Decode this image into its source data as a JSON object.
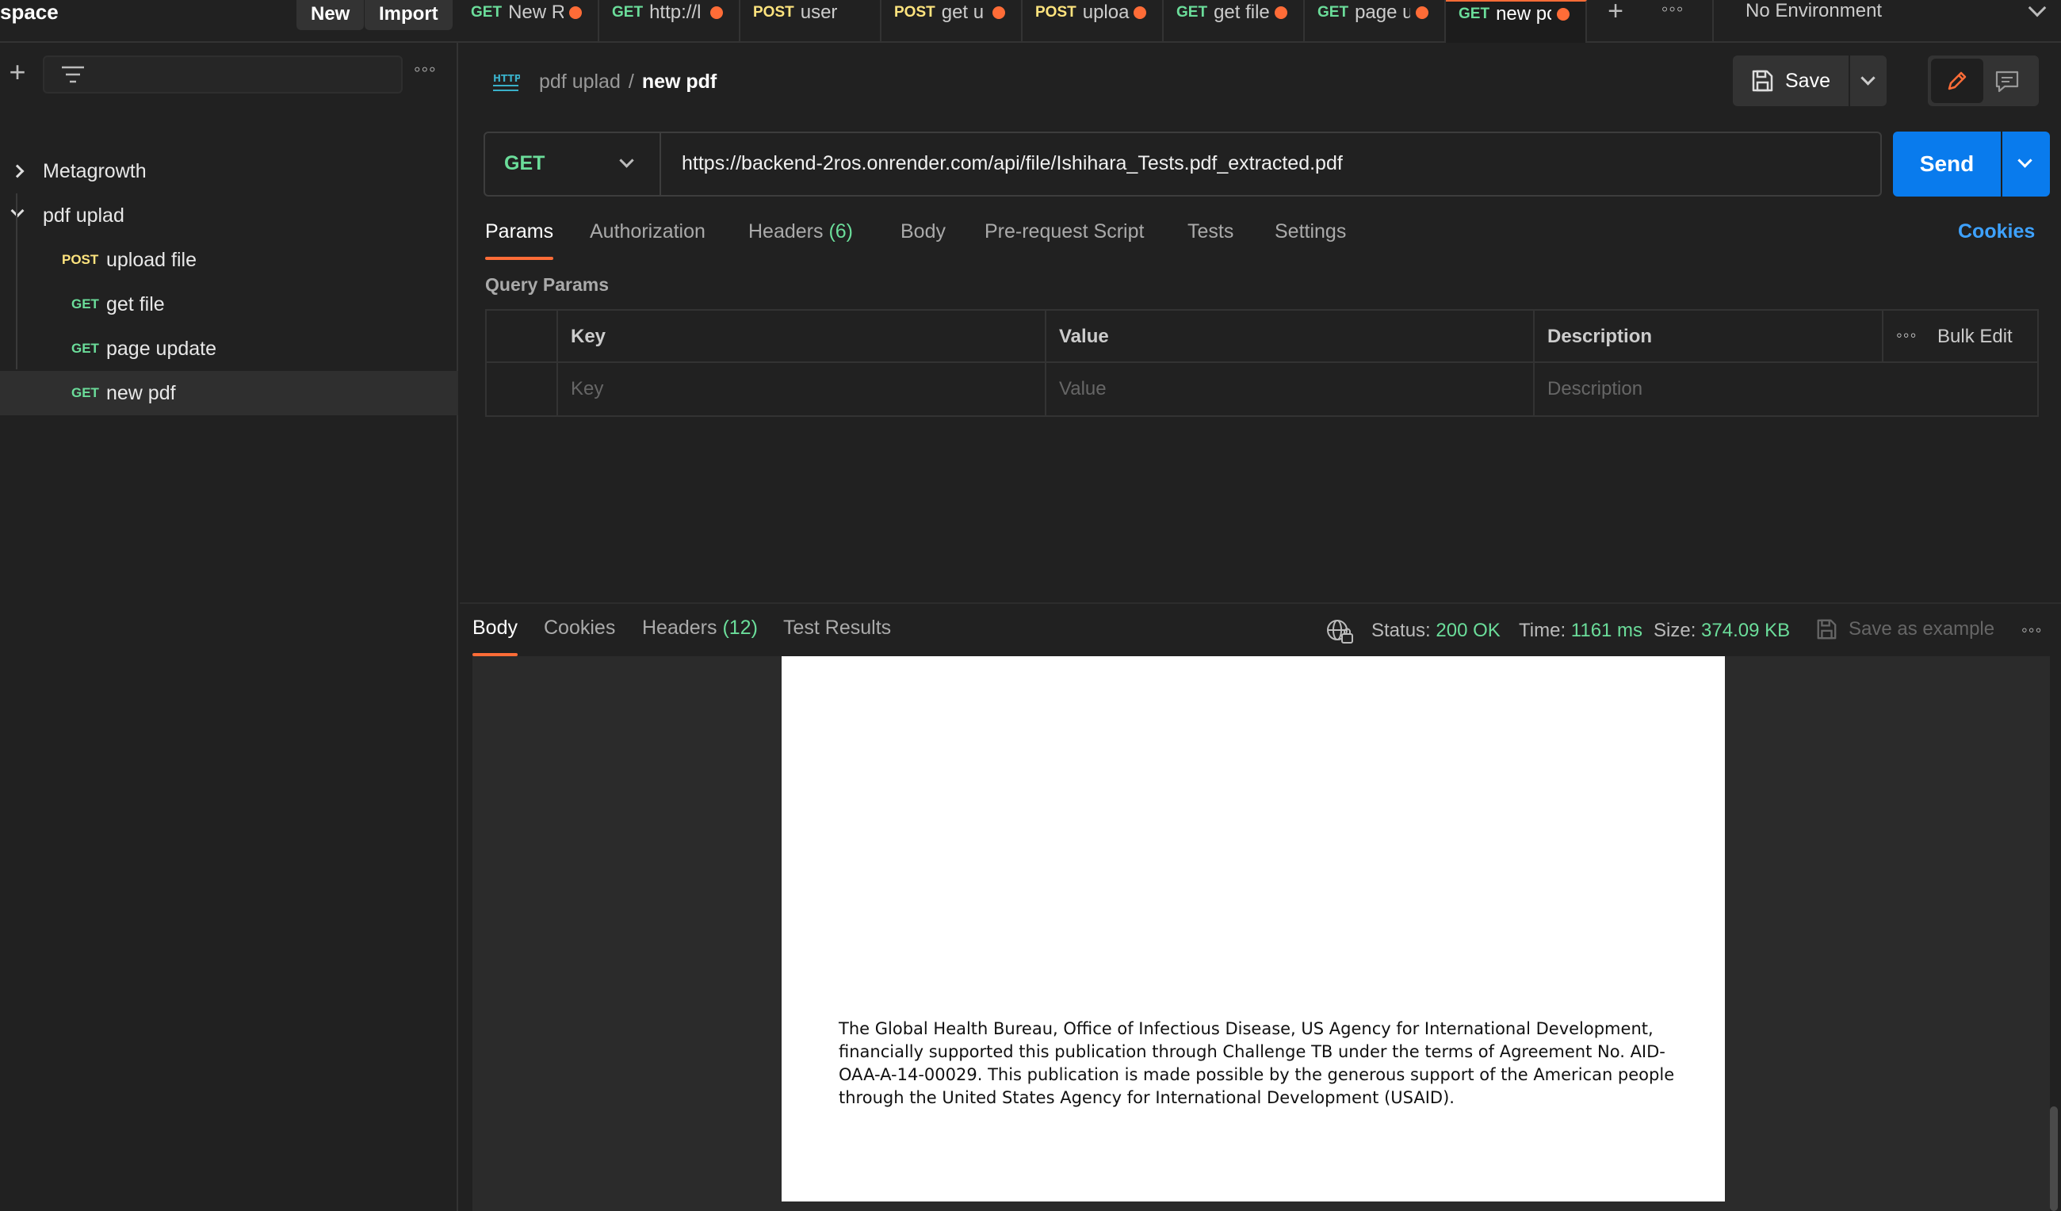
{
  "workspace": {
    "title": "space",
    "new_label": "New",
    "import_label": "Import"
  },
  "tabs": [
    {
      "method": "GET",
      "name": "New R"
    },
    {
      "method": "GET",
      "name": "http://l"
    },
    {
      "method": "POST",
      "name": "user"
    },
    {
      "method": "POST",
      "name": "get u"
    },
    {
      "method": "POST",
      "name": "uploa"
    },
    {
      "method": "GET",
      "name": "get file"
    },
    {
      "method": "GET",
      "name": "page u"
    },
    {
      "method": "GET",
      "name": "new pc"
    }
  ],
  "environment": {
    "label": "No Environment"
  },
  "sidebar": {
    "collections": [
      {
        "name": "Metagrowth",
        "expanded": false
      },
      {
        "name": "pdf uplad",
        "expanded": true
      }
    ],
    "requests": [
      {
        "method": "POST",
        "name": "upload file"
      },
      {
        "method": "GET",
        "name": "get file"
      },
      {
        "method": "GET",
        "name": "page update"
      },
      {
        "method": "GET",
        "name": "new pdf"
      }
    ]
  },
  "request": {
    "breadcrumb_collection": "pdf uplad",
    "breadcrumb_separator": "/",
    "breadcrumb_name": "new pdf",
    "save_label": "Save",
    "method": "GET",
    "url": "https://backend-2ros.onrender.com/api/file/Ishihara_Tests.pdf_extracted.pdf",
    "send_label": "Send",
    "tabs": {
      "params": "Params",
      "authorization": "Authorization",
      "headers": "Headers",
      "headers_count": "(6)",
      "body": "Body",
      "prerequest": "Pre-request Script",
      "tests": "Tests",
      "settings": "Settings"
    },
    "cookies_label": "Cookies",
    "query_params_title": "Query Params",
    "table": {
      "col_key": "Key",
      "col_value": "Value",
      "col_description": "Description",
      "bulk_edit": "Bulk Edit",
      "ph_key": "Key",
      "ph_value": "Value",
      "ph_description": "Description"
    }
  },
  "response": {
    "tabs": {
      "body": "Body",
      "cookies": "Cookies",
      "headers": "Headers",
      "headers_count": "(12)",
      "test_results": "Test Results"
    },
    "status_label": "Status:",
    "status_value": "200 OK",
    "time_label": "Time:",
    "time_value": "1161 ms",
    "size_label": "Size:",
    "size_value": "374.09 KB",
    "save_example_label": "Save as example",
    "pdf_text": "The Global Health Bureau, Office of Infectious Disease, US Agency for International Development, financially supported this publication through Challenge TB under the terms of Agreement No. AID-OAA-A-14-00029. This publication is made possible by the generous support of the American people through the United States Agency for International Development (USAID)."
  },
  "colors": {
    "accent": "#ff6c37",
    "send_blue": "#097bed",
    "get_green": "#6bdd9a",
    "post_yellow": "#ffe47e",
    "link_blue": "#3ea2ff"
  },
  "icons": [
    "plus-icon",
    "more-icon",
    "filter-icon",
    "chevron-down-icon",
    "chevron-right-icon",
    "http-icon",
    "save-icon",
    "pencil-icon",
    "comment-icon",
    "globe-lock-icon"
  ]
}
